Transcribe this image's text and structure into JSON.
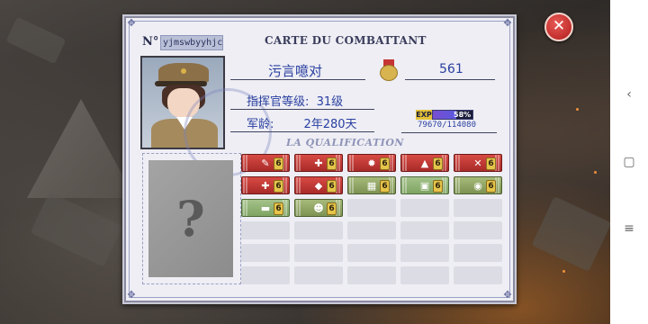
{
  "card": {
    "no_label": "N°",
    "player_id": "yjmswbyyhjc",
    "title": "CARTE DU COMBATTANT",
    "name": "污言噫对",
    "honor_value": "561",
    "level_text": "指挥官等级:  31级",
    "service_age_text": "军龄:        2年280天",
    "qualification_title": "LA QUALIFICATION"
  },
  "experience": {
    "tag": "EXP",
    "percent_text": "58%",
    "percent": 58,
    "current_total_text": "79670/114080"
  },
  "badges": [
    {
      "style": "red",
      "icon": "pen-icon",
      "glyph": "✎",
      "count": "6"
    },
    {
      "style": "red",
      "icon": "syringe-icon",
      "glyph": "✚",
      "count": "6"
    },
    {
      "style": "red",
      "icon": "grenade-icon",
      "glyph": "✹",
      "count": "6"
    },
    {
      "style": "red",
      "icon": "bullet-icon",
      "glyph": "▲",
      "count": "6"
    },
    {
      "style": "red",
      "icon": "wrench-icon",
      "glyph": "✕",
      "count": "6"
    },
    {
      "style": "red",
      "icon": "bandage-icon",
      "glyph": "✚",
      "count": "6"
    },
    {
      "style": "red",
      "icon": "knife-icon",
      "glyph": "◆",
      "count": "6"
    },
    {
      "style": "green",
      "icon": "map-icon",
      "glyph": "▦",
      "count": "6"
    },
    {
      "style": "teal",
      "icon": "supply-box-icon",
      "glyph": "▣",
      "count": "6"
    },
    {
      "style": "green",
      "icon": "target-icon",
      "glyph": "◉",
      "count": "6"
    },
    {
      "style": "teal",
      "icon": "tank-icon",
      "glyph": "▬",
      "count": "6"
    },
    {
      "style": "green",
      "icon": "soldier-icon",
      "glyph": "☻",
      "count": "6"
    }
  ],
  "colors": {
    "card_bg": "#eeeef4",
    "ink_blue": "#2a3fa0",
    "badge_red": "#c8403c",
    "badge_green": "#93a866",
    "close_red": "#c62828"
  },
  "close_icon_glyph": "✕",
  "nav": {
    "back_glyph": "‹",
    "home_glyph": "▢",
    "menu_glyph": "≡"
  }
}
